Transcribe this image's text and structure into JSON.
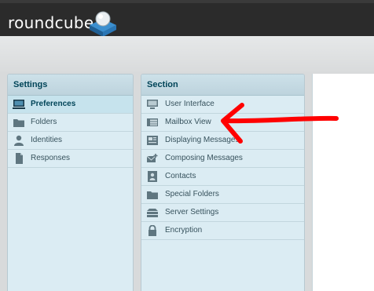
{
  "app": {
    "logo_text": "roundcube"
  },
  "settings": {
    "title": "Settings",
    "items": [
      {
        "label": "Preferences",
        "icon": "monitor-icon",
        "selected": true
      },
      {
        "label": "Folders",
        "icon": "folder-icon"
      },
      {
        "label": "Identities",
        "icon": "person-icon"
      },
      {
        "label": "Responses",
        "icon": "document-icon"
      }
    ]
  },
  "section": {
    "title": "Section",
    "items": [
      {
        "label": "User Interface",
        "icon": "monitor-icon"
      },
      {
        "label": "Mailbox View",
        "icon": "list-icon"
      },
      {
        "label": "Displaying Messages",
        "icon": "newspaper-icon"
      },
      {
        "label": "Composing Messages",
        "icon": "compose-icon"
      },
      {
        "label": "Contacts",
        "icon": "contacts-icon"
      },
      {
        "label": "Special Folders",
        "icon": "folder-icon"
      },
      {
        "label": "Server Settings",
        "icon": "server-icon"
      },
      {
        "label": "Encryption",
        "icon": "lock-icon"
      }
    ]
  },
  "colors": {
    "annotation": "#ff0000",
    "panel_bg": "#dbecf3",
    "header_text": "#004458"
  }
}
